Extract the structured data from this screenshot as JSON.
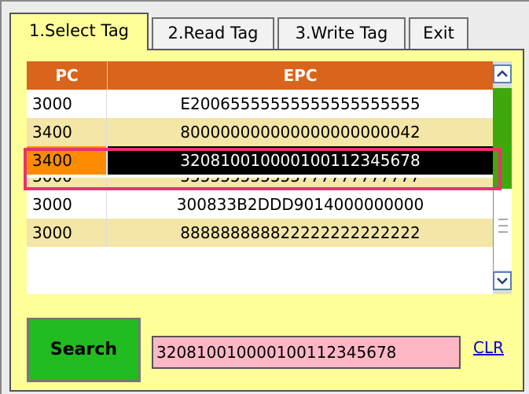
{
  "tabs": [
    {
      "label": "1.Select Tag",
      "active": true
    },
    {
      "label": "2.Read Tag",
      "active": false
    },
    {
      "label": "3.Write Tag",
      "active": false
    },
    {
      "label": "Exit",
      "active": false
    }
  ],
  "table": {
    "columns": [
      "PC",
      "EPC"
    ],
    "rows": [
      {
        "pc": "3000",
        "epc": "E20065555555555555555555"
      },
      {
        "pc": "3400",
        "epc": "800000000000000000000042"
      },
      {
        "pc": "3400",
        "epc": "320810010000100112345678",
        "selected": true
      },
      {
        "pc": "3000",
        "epc": "555555555555777777777777"
      },
      {
        "pc": "3000",
        "epc": "300833B2DDD9014000000000"
      },
      {
        "pc": "3000",
        "epc": "888888888822222222222222"
      }
    ]
  },
  "scrollbar": {
    "up_icon": "chevron-up-icon",
    "down_icon": "chevron-down-icon"
  },
  "search_button": {
    "label": "Search"
  },
  "selected_epc": "320810010000100112345678",
  "clear_link": {
    "label": "CLR"
  },
  "colors": {
    "panel": "#ffff99",
    "header": "#d9651c",
    "selected_row": "#000000",
    "selected_pc": "#ff8c00",
    "search_button": "#22bb22",
    "result_field": "#ffb7c5",
    "highlight": "#e8336e"
  }
}
